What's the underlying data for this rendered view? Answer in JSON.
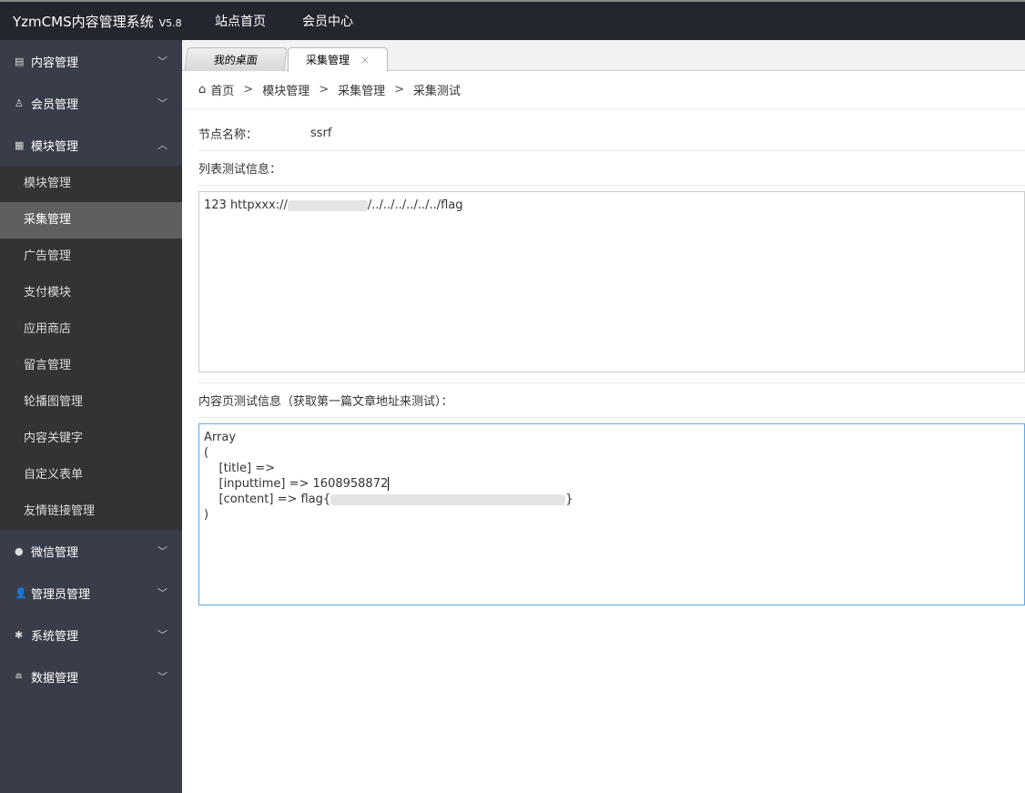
{
  "header": {
    "title": "YzmCMS内容管理系统",
    "version": "V5.8",
    "nav": [
      "站点首页",
      "会员中心"
    ]
  },
  "sidebar": {
    "groups_top": [
      {
        "label": "内容管理",
        "icon": "book-icon"
      },
      {
        "label": "会员管理",
        "icon": "user-icon"
      },
      {
        "label": "模块管理",
        "icon": "grid-icon"
      }
    ],
    "sub_items": [
      "模块管理",
      "采集管理",
      "广告管理",
      "支付模块",
      "应用商店",
      "留言管理",
      "轮播图管理",
      "内容关键字",
      "自定义表单",
      "友情链接管理"
    ],
    "active": "采集管理",
    "groups_bottom": [
      {
        "label": "微信管理",
        "icon": "wechat-icon"
      },
      {
        "label": "管理员管理",
        "icon": "admin-icon"
      },
      {
        "label": "系统管理",
        "icon": "gear-icon"
      },
      {
        "label": "数据管理",
        "icon": "database-icon"
      }
    ]
  },
  "tabs": [
    {
      "label": "我的桌面"
    },
    {
      "label": "采集管理",
      "close": "×"
    }
  ],
  "breadcrumb": [
    "首页",
    "模块管理",
    "采集管理",
    "采集测试"
  ],
  "form": {
    "node_label": "节点名称：",
    "node_value": "ssrf",
    "list_label": "列表测试信息：",
    "list_prefix": "123 httpxxx://",
    "list_suffix": "/../../../../../../flag",
    "content_label": "内容页测试信息（获取第一篇文章地址来测试）：",
    "content_lines": [
      "Array",
      "(",
      "    [title] => ",
      "    [inputtime] => 1608958872",
      "    [content] => flag{"
    ],
    "content_close_brace": "}",
    "content_end": ")"
  }
}
